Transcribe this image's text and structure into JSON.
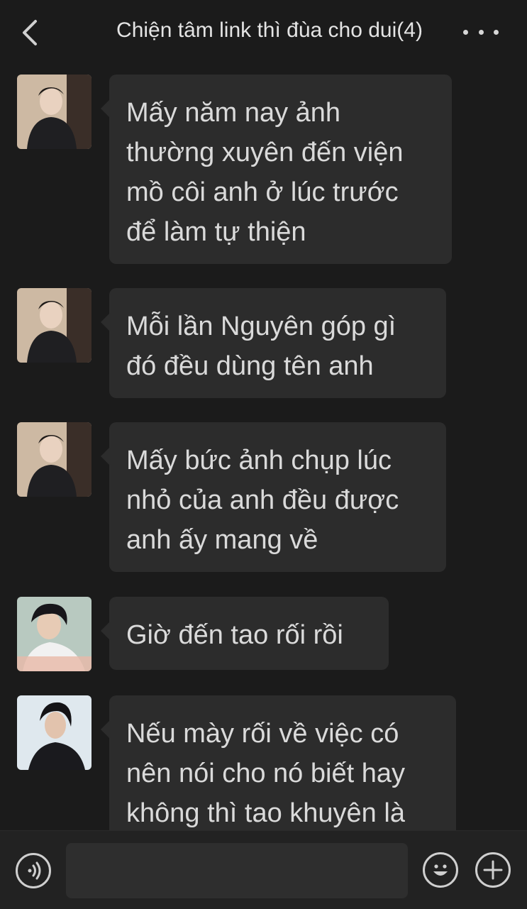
{
  "header": {
    "title": "Chiện tâm link thì đùa cho dui(4)",
    "back_icon": "chevron-left-icon",
    "more_icon": "more-dots-icon"
  },
  "messages": [
    {
      "sender": "avatar-1",
      "text": "Mấy năm nay ảnh thường xuyên đến viện mồ côi anh ở lúc trước để làm tự thiện"
    },
    {
      "sender": "avatar-1",
      "text": "Mỗi lần Nguyên góp gì đó đều dùng tên anh"
    },
    {
      "sender": "avatar-1",
      "text": "Mấy bức ảnh chụp lúc nhỏ của anh đều được anh ấy mang về"
    },
    {
      "sender": "avatar-2",
      "text": "Giờ đến tao rối rồi"
    },
    {
      "sender": "avatar-3",
      "text": "Nếu mày rối về việc có nên nói cho nó biết hay không thì tao khuyên là"
    }
  ],
  "composer": {
    "voice_icon": "voice-icon",
    "emoji_icon": "emoji-icon",
    "plus_icon": "plus-icon",
    "input_value": ""
  },
  "colors": {
    "background": "#1b1b1b",
    "bubble": "#2c2c2c",
    "text": "#dadada"
  }
}
